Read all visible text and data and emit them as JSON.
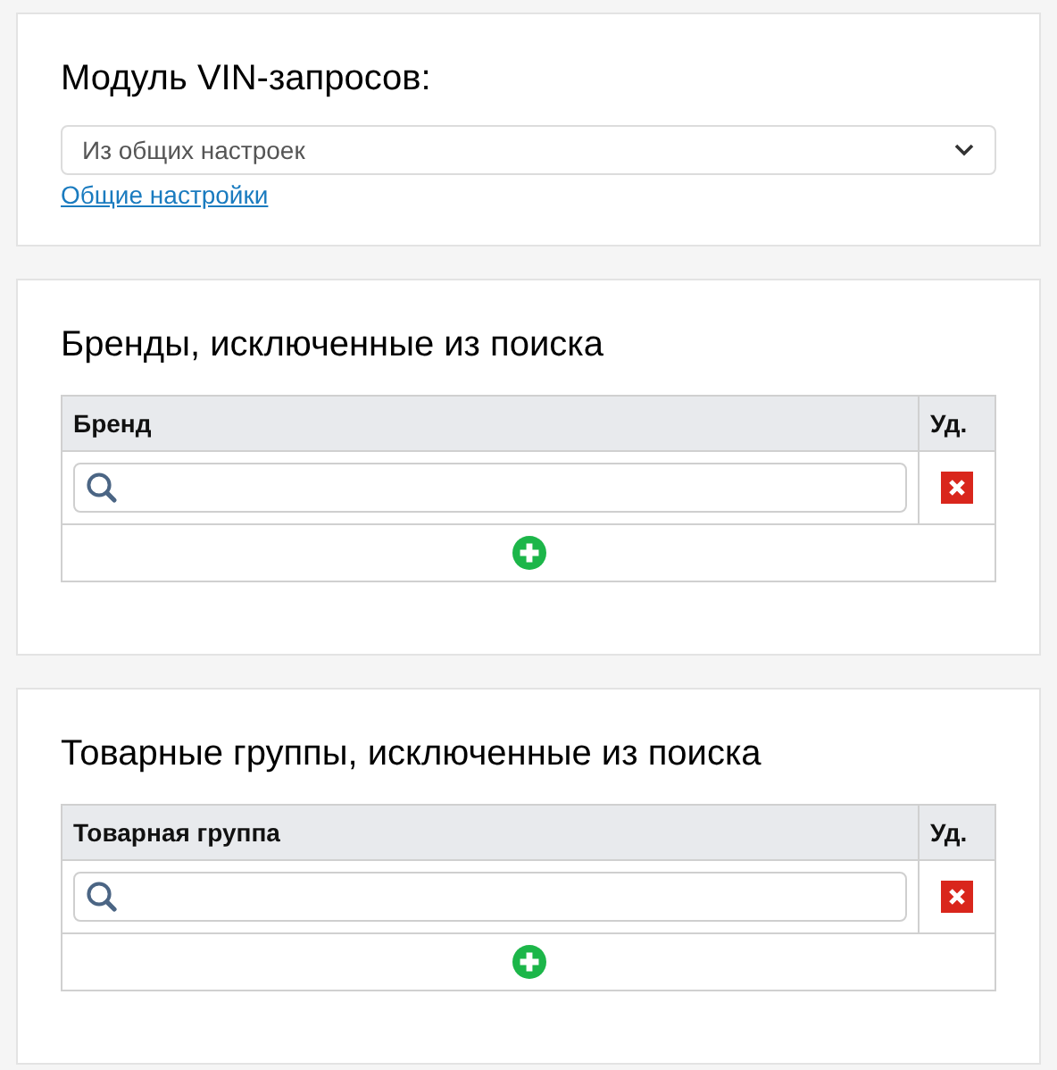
{
  "vin_module": {
    "title": "Модуль VIN-запросов:",
    "select_value": "Из общих настроек",
    "link": "Общие настройки"
  },
  "sections": [
    {
      "title": "Бренды, исключенные из поиска",
      "columns": [
        "Бренд",
        "Уд."
      ]
    },
    {
      "title": "Товарные группы, исключенные из поиска",
      "columns": [
        "Товарная группа",
        "Уд."
      ]
    }
  ]
}
